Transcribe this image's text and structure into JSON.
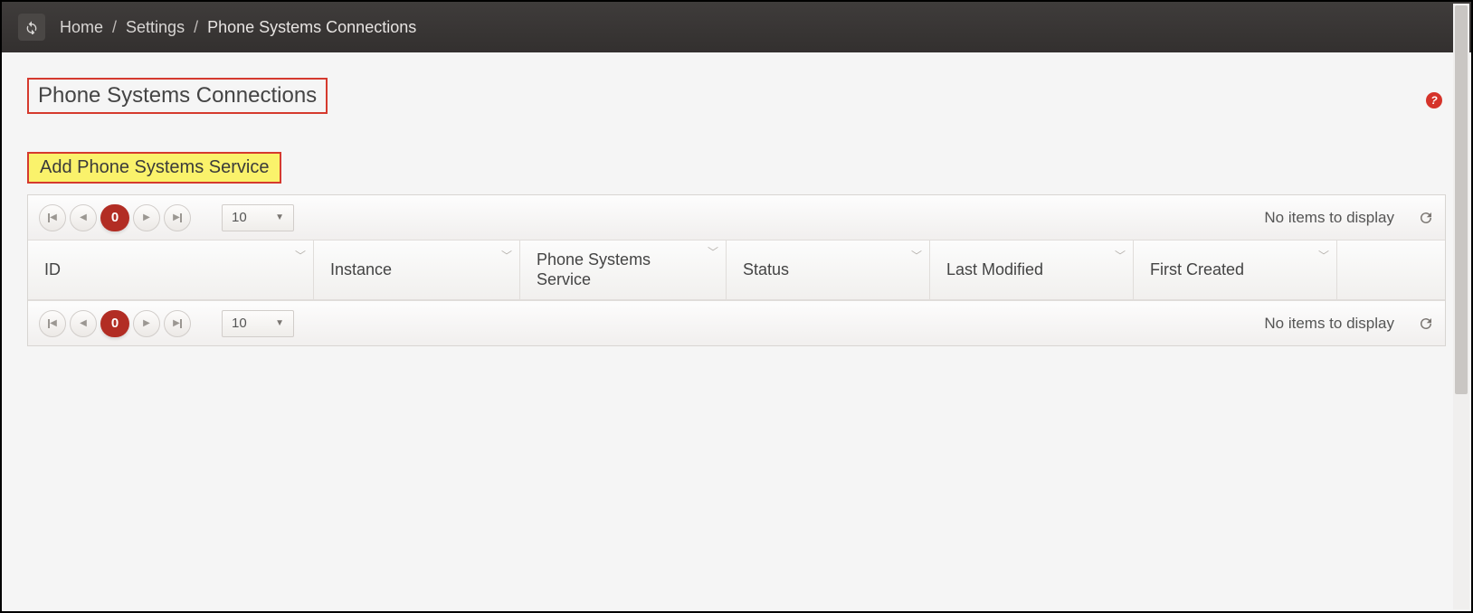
{
  "breadcrumb": {
    "items": [
      "Home",
      "Settings",
      "Phone Systems Connections"
    ]
  },
  "page": {
    "title": "Phone Systems Connections",
    "add_button_label": "Add Phone Systems Service",
    "help_glyph": "?"
  },
  "grid": {
    "page_number": "0",
    "page_size": "10",
    "status_text": "No items to display",
    "columns": [
      {
        "label": "ID"
      },
      {
        "label": "Instance"
      },
      {
        "label": "Phone Systems Service"
      },
      {
        "label": "Status"
      },
      {
        "label": "Last Modified"
      },
      {
        "label": "First Created"
      }
    ],
    "rows": []
  }
}
